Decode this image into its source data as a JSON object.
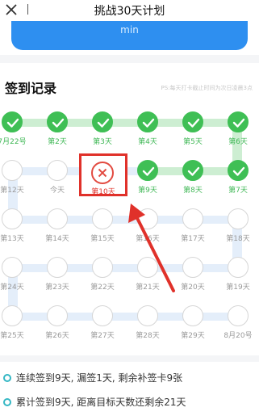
{
  "header": {
    "title": "挑战30天计划"
  },
  "banner": {
    "unit": "min"
  },
  "section": {
    "title": "签到记录",
    "note": "PS:每天打卡截止时间为次日凌晨3点"
  },
  "grid": {
    "row1": [
      "7月22号",
      "第2天",
      "第3天",
      "第4天",
      "第5天",
      "第6天"
    ],
    "row2": [
      "第12天",
      "今天",
      "第10天",
      "第9天",
      "第8天",
      "第7天"
    ],
    "row3": [
      "第13天",
      "第14天",
      "第15天",
      "第16天",
      "第17天",
      "第18天"
    ],
    "row4": [
      "第24天",
      "第23天",
      "第22天",
      "第21天",
      "第20天",
      "第19天"
    ],
    "row5": [
      "第25天",
      "第26天",
      "第27天",
      "第28天",
      "第29天",
      "8月20号"
    ]
  },
  "stats": {
    "line1": "连续签到9天, 漏签1天, 剩余补签卡9张",
    "line2": "累计签到9天, 距离目标天数还剩余21天"
  },
  "colors": {
    "done": "#3fbf55",
    "missed": "#e0312a",
    "accent": "#2e8ff0"
  }
}
